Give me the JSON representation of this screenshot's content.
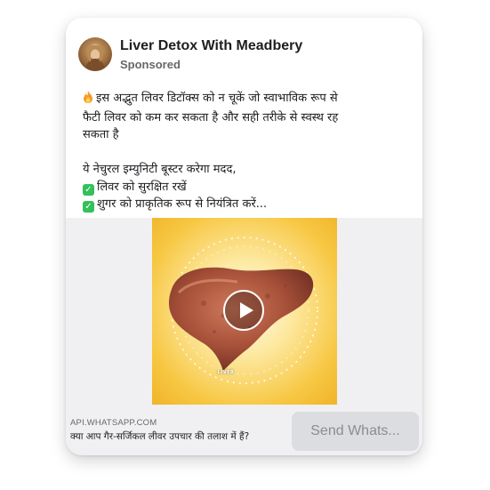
{
  "post": {
    "page_name": "Liver Detox With Meadbery",
    "sponsored_label": "Sponsored",
    "text_lines": [
      "इस अद्भुत लिवर डिटॉक्स को न चूकें जो स्वाभाविक रूप से",
      "फैटी लिवर को कम कर सकता है और सही तरीके से स्वस्थ रह",
      "सकता है"
    ],
    "benefits_intro": "ये नेचुरल इम्युनिटी बूस्टर करेगा मदद,",
    "benefits": [
      "लिवर को सुरक्षित रखें",
      "शुगर को प्राकृतिक रूप से नियंत्रित करें..."
    ],
    "icons": {
      "lead_icon": "fire-icon",
      "benefit_icon": "check-mark-icon",
      "play_icon": "play-icon",
      "avatar": "avatar-image"
    }
  },
  "media": {
    "overlay_label": "LIVER"
  },
  "cta": {
    "domain": "API.WHATSAPP.COM",
    "headline": "क्या आप गैर-सर्जिकल लीवर उपचार की तलाश में हैं?",
    "button_label": "Send Whats..."
  },
  "colors": {
    "check": "#34c05a",
    "video_background": "#f7c742",
    "cta_button": "#dcdde1"
  }
}
